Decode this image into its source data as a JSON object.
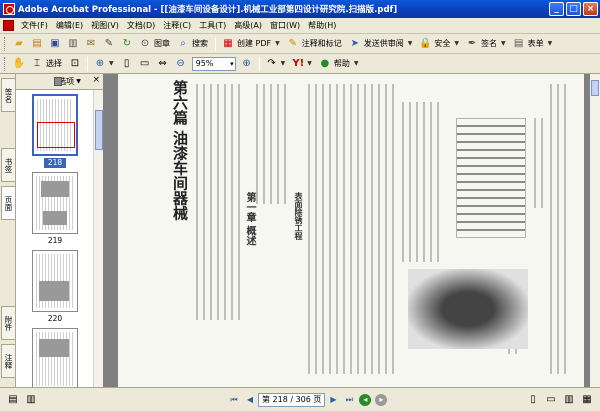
{
  "window": {
    "title": "Adobe Acrobat Professional - [[油漆车间设备设计].机械工业部第四设计研究院.扫描版.pdf]",
    "controls": [
      "_",
      "□",
      "×"
    ]
  },
  "menu": {
    "items": [
      "文件(F)",
      "编辑(E)",
      "视图(V)",
      "文档(D)",
      "注释(C)",
      "工具(T)",
      "高级(A)",
      "窗口(W)",
      "帮助(H)"
    ]
  },
  "toolbar1": {
    "image_label": "图章",
    "search_label": "搜索",
    "create_pdf_label": "创建 PDF",
    "comment_label": "注释和标记",
    "send_review_label": "发送供审阅",
    "security_label": "安全",
    "sign_label": "签名",
    "forms_label": "表单"
  },
  "toolbar2": {
    "select_label": "选择",
    "zoom_value": "95%",
    "help_label": "帮助"
  },
  "side_tabs": [
    "签名",
    "书签",
    "页面",
    "附件",
    "注释"
  ],
  "thumbnails": {
    "options_label": "选项",
    "pages": [
      "218",
      "219",
      "220"
    ],
    "selected": "218"
  },
  "document": {
    "chapter_title": "第六篇  油漆车间器械",
    "section_title": "第一章  概述",
    "subsection_title": "表面除锈工程"
  },
  "status": {
    "page_display": "第 218 / 306 页"
  },
  "colors": {
    "title_bar": "#0b3fb8",
    "selected_thumb": "#3a63c0"
  }
}
